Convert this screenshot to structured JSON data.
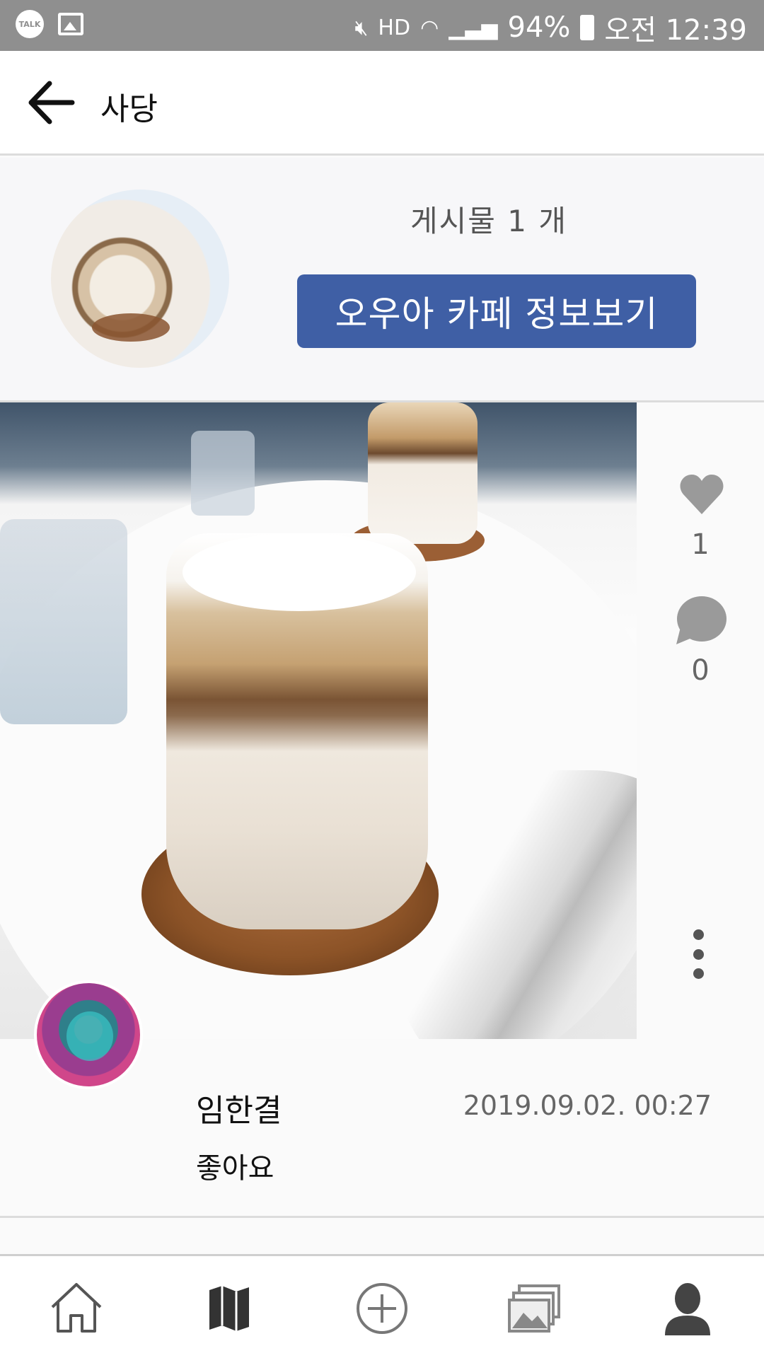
{
  "status_bar": {
    "talk_icon": "kakaotalk-icon",
    "talk_label": "TALK",
    "battery": "94%",
    "time": "오전 12:39",
    "hd_label": "HD"
  },
  "app_bar": {
    "title": "사당"
  },
  "header": {
    "post_count": "게시물   1 개",
    "info_button": "오우아 카페  정보보기"
  },
  "post": {
    "likes": "1",
    "comments": "0",
    "user_name": "임한결",
    "date": "2019.09.02. 00:27",
    "text": "좋아요"
  },
  "bottom_nav": {
    "items": [
      "home-icon",
      "map-icon",
      "add-icon",
      "gallery-icon",
      "profile-icon"
    ]
  },
  "colors": {
    "accent": "#3f5fa5",
    "status_bar": "#8f8f8f"
  }
}
